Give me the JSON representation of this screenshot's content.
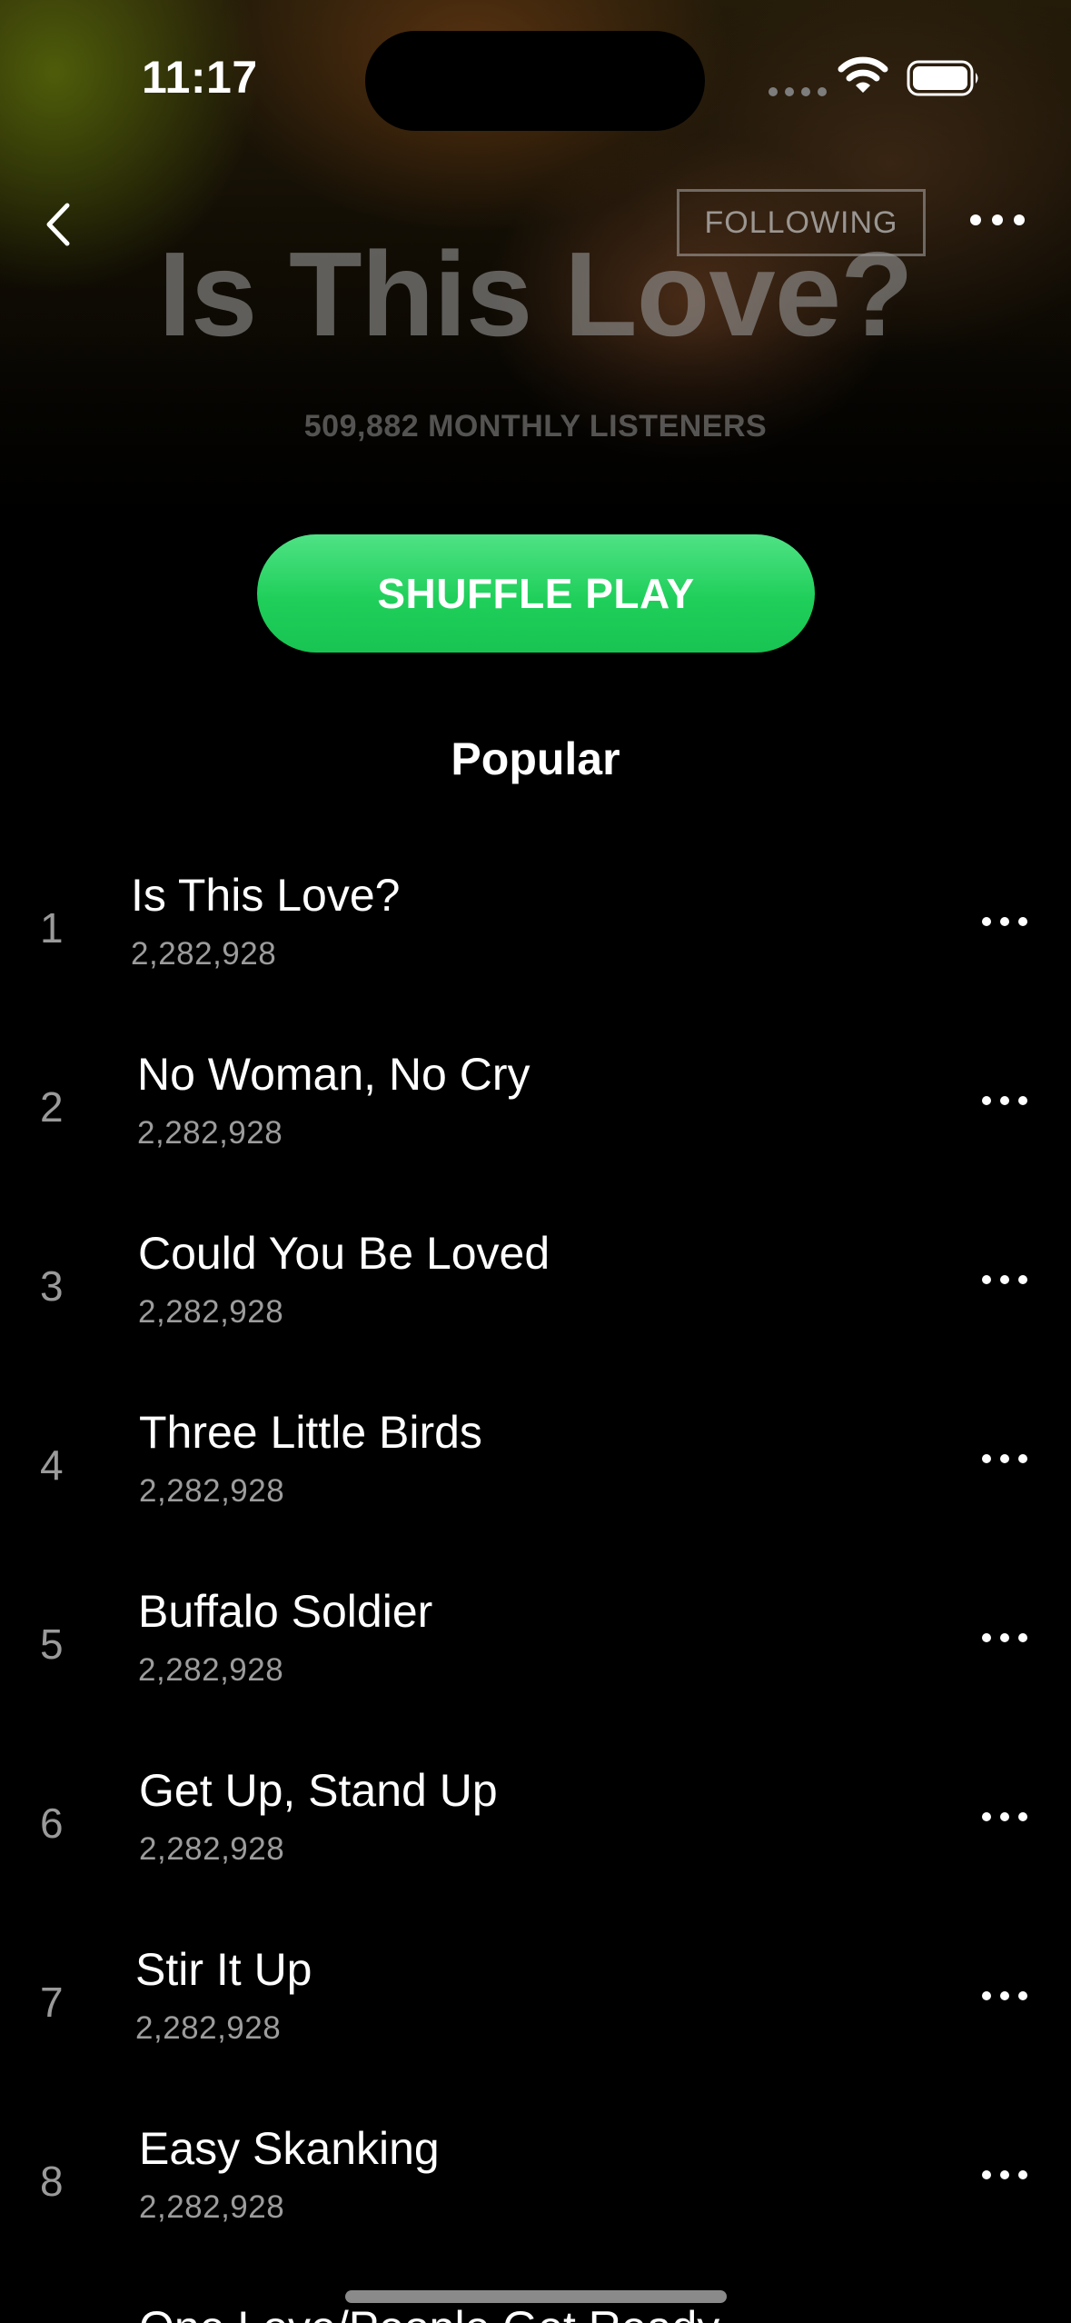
{
  "status_bar": {
    "time": "11:17"
  },
  "header": {
    "following_label": "FOLLOWING",
    "title": "Is This Love?",
    "listeners": "509,882 MONTHLY LISTENERS"
  },
  "shuffle_label": "SHUFFLE PLAY",
  "section_title": "Popular",
  "tracks": [
    {
      "number": "1",
      "title": "Is This Love?",
      "plays": "2,282,928"
    },
    {
      "number": "2",
      "title": "No Woman, No Cry",
      "plays": "2,282,928"
    },
    {
      "number": "3",
      "title": "Could You Be Loved",
      "plays": "2,282,928"
    },
    {
      "number": "4",
      "title": "Three Little Birds",
      "plays": "2,282,928"
    },
    {
      "number": "5",
      "title": "Buffalo Soldier",
      "plays": "2,282,928"
    },
    {
      "number": "6",
      "title": "Get Up, Stand Up",
      "plays": "2,282,928"
    },
    {
      "number": "7",
      "title": "Stir It Up",
      "plays": "2,282,928"
    },
    {
      "number": "8",
      "title": "Easy Skanking",
      "plays": "2,282,928"
    },
    {
      "number": "",
      "title": "One Love/People Get Ready",
      "plays": ""
    }
  ],
  "colors": {
    "accent": "#1ed760",
    "background": "#000000",
    "secondary_text": "#9c9c9c"
  },
  "icons": {
    "back": "chevron-left-icon",
    "more": "more-horizontal-icon",
    "wifi": "wifi-icon",
    "battery": "battery-icon"
  }
}
